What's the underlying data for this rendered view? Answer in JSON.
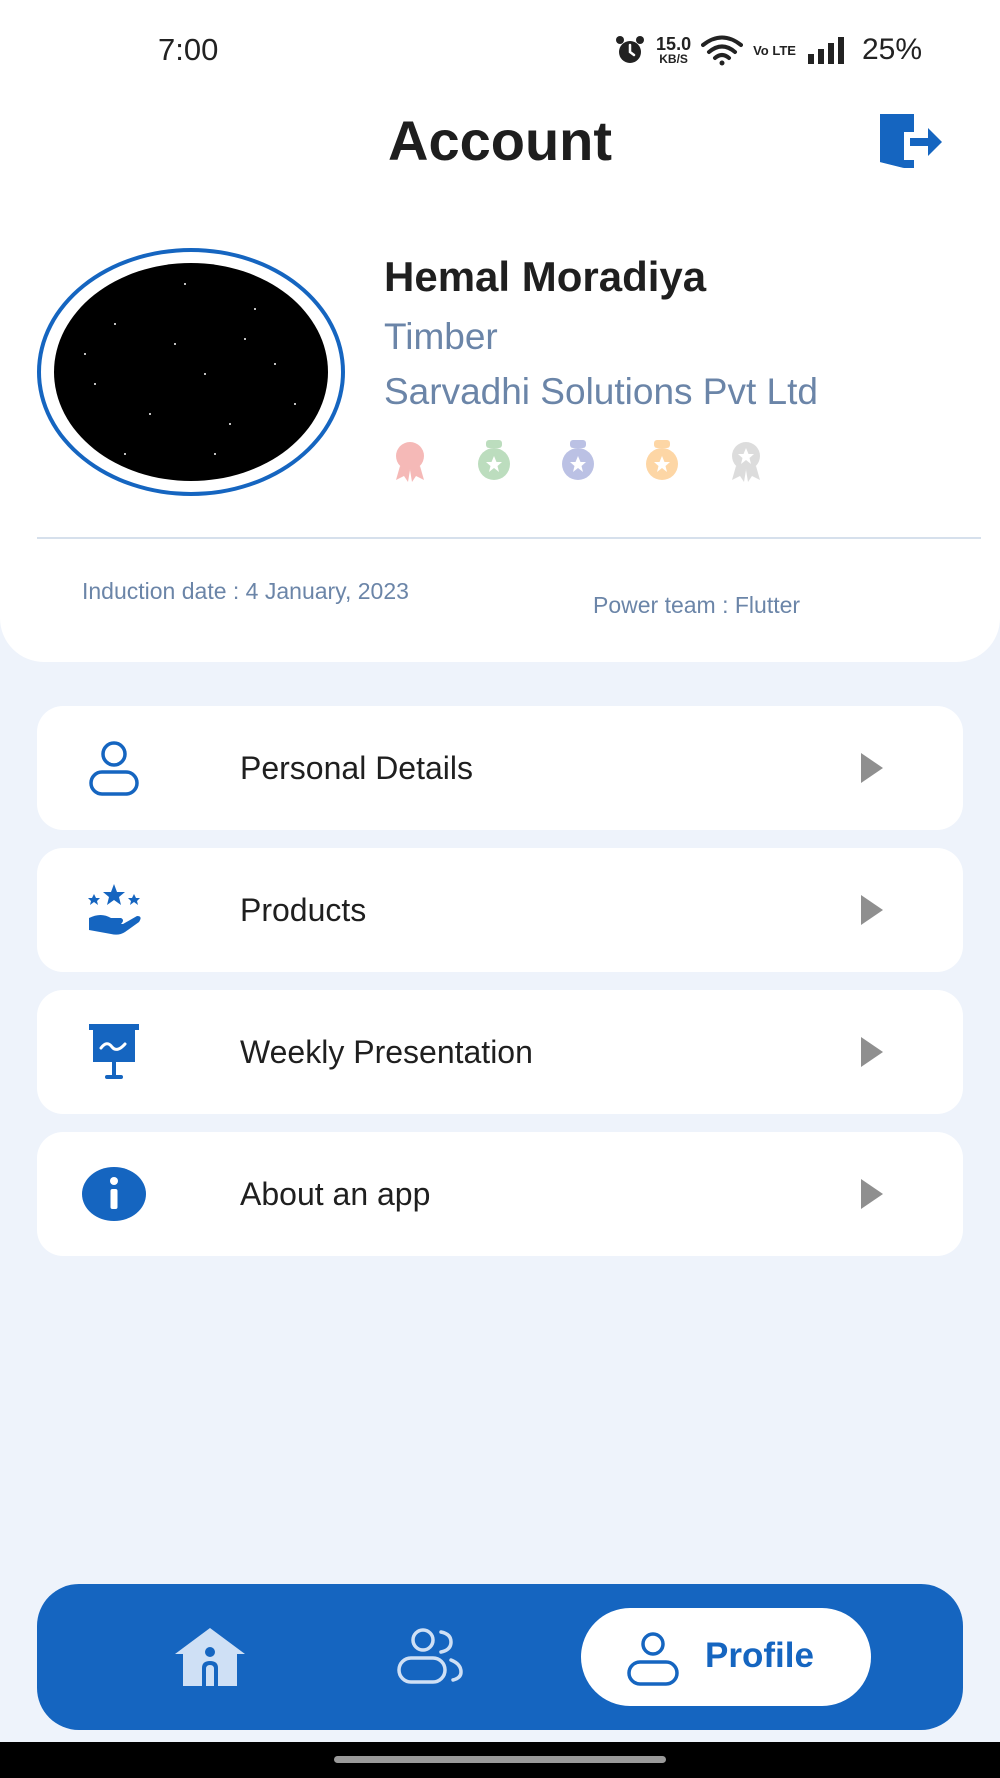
{
  "status_bar": {
    "time": "7:00",
    "speed_value": "15.0",
    "speed_unit": "KB/S",
    "volte": "Vo LTE",
    "battery": "25%"
  },
  "header": {
    "title": "Account"
  },
  "profile": {
    "name": "Hemal Moradiya",
    "role": "Timber",
    "company": "Sarvadhi Solutions Pvt Ltd",
    "badges": [
      "medal-red-icon",
      "medal-green-icon",
      "medal-blue-icon",
      "medal-orange-icon",
      "medal-grey-icon"
    ]
  },
  "info": {
    "induction": "Induction date : 4 January, 2023",
    "power_team": "Power team : Flutter"
  },
  "menu": [
    {
      "label": "Personal Details",
      "icon": "person-icon"
    },
    {
      "label": "Products",
      "icon": "products-hand-stars-icon"
    },
    {
      "label": "Weekly Presentation",
      "icon": "presentation-board-icon"
    },
    {
      "label": "About an app",
      "icon": "info-icon"
    }
  ],
  "bottom_nav": {
    "home_icon": "home-icon",
    "team_icon": "team-icon",
    "profile_label": "Profile"
  },
  "colors": {
    "accent": "#1565c0",
    "background": "#eef3fb",
    "muted_text": "#6b85a8"
  }
}
